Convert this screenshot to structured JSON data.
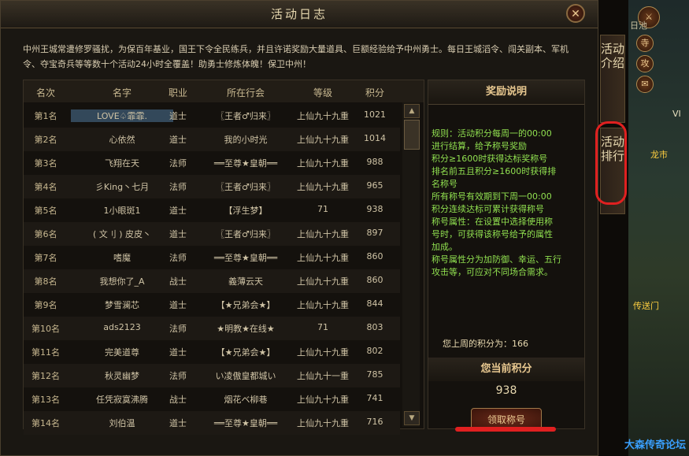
{
  "window": {
    "title": "活动日志",
    "close_label": "✕"
  },
  "intro": "中州王城常遭修罗骚扰，为保百年基业，国王下令全民练兵，并且许诺奖励大量道具、巨额经验给予中州勇士。每日王城滔令、闯关副本、军机令、夺宝奇兵等等数十个活动24小时全覆盖！助勇士修炼体魄！保卫中州！",
  "table": {
    "headers": [
      "名次",
      "名字",
      "职业",
      "所在行会",
      "等级",
      "积分"
    ],
    "rows": [
      {
        "rank": "第1名",
        "name": "LOVE♤霏霏.",
        "job": "道士",
        "guild": "〖王者♂归来〗",
        "level": "上仙九十九重",
        "score": "1021"
      },
      {
        "rank": "第2名",
        "name": "心依然",
        "job": "道士",
        "guild": "我的小时光",
        "level": "上仙九十九重",
        "score": "1014"
      },
      {
        "rank": "第3名",
        "name": "飞翔在天",
        "job": "法师",
        "guild": "══至尊★皇朝══",
        "level": "上仙九十九重",
        "score": "988"
      },
      {
        "rank": "第4名",
        "name": "彡King丶七月",
        "job": "法师",
        "guild": "〖王者♂归来〗",
        "level": "上仙九十九重",
        "score": "965"
      },
      {
        "rank": "第5名",
        "name": "1小眼斑1",
        "job": "道士",
        "guild": "【浮生梦】",
        "level": "71",
        "score": "938"
      },
      {
        "rank": "第6名",
        "name": "( 文刂 ) 皮皮丶",
        "job": "道士",
        "guild": "〖王者♂归来〗",
        "level": "上仙九十九重",
        "score": "897"
      },
      {
        "rank": "第7名",
        "name": "嗜魔",
        "job": "法师",
        "guild": "══至尊★皇朝══",
        "level": "上仙九十九重",
        "score": "860"
      },
      {
        "rank": "第8名",
        "name": "我想你了_A",
        "job": "战士",
        "guild": "義薄云天",
        "level": "上仙九十九重",
        "score": "860"
      },
      {
        "rank": "第9名",
        "name": "梦雪澜芯",
        "job": "道士",
        "guild": "【★兄弟会★】",
        "level": "上仙九十九重",
        "score": "844"
      },
      {
        "rank": "第10名",
        "name": "ads2123",
        "job": "法师",
        "guild": "★明教★在线★",
        "level": "71",
        "score": "803"
      },
      {
        "rank": "第11名",
        "name": "完美道尊",
        "job": "道士",
        "guild": "【★兄弟会★】",
        "level": "上仙九十九重",
        "score": "802"
      },
      {
        "rank": "第12名",
        "name": "秋灵幽梦",
        "job": "法师",
        "guild": "い凌傲皇都城い",
        "level": "上仙九十一重",
        "score": "785"
      },
      {
        "rank": "第13名",
        "name": "任凭寂寞沸腾",
        "job": "战士",
        "guild": "烟花ベ柳巷",
        "level": "上仙九十九重",
        "score": "741"
      },
      {
        "rank": "第14名",
        "name": "刘伯温",
        "job": "道士",
        "guild": "══至尊★皇朝══",
        "level": "上仙九十九重",
        "score": "716"
      }
    ]
  },
  "scrollbar": {
    "up": "▲",
    "down": "▼"
  },
  "reward_panel": {
    "title": "奖励说明",
    "rules": [
      "规则：活动积分每周一的00:00",
      "进行结算，给予称号奖励",
      "积分≥1600时获得达标奖称号",
      "排名前五且积分≥1600时获得排",
      "名称号",
      "所有称号有效期到下周一00:00",
      "积分连续达标可累计获得称号",
      "称号属性：在设置中选择使用称",
      "号时，可获得该称号给予的属性",
      "加成。",
      "称号属性分为加防御、幸运、五行",
      "攻击等，可应对不同场合需求。"
    ],
    "last_week_label": "您上周的积分为：",
    "last_week_value": "166",
    "current_title": "您当前积分",
    "current_value": "938",
    "claim_button": "领取称号"
  },
  "side_tabs": [
    {
      "label": "活动介绍"
    },
    {
      "label": "活动排行"
    }
  ],
  "scene": {
    "buttons": [
      "寺",
      "攻",
      "✉"
    ],
    "labels": [
      "日池",
      "龙市",
      "传送门",
      "VI"
    ],
    "watermark": "大森传奇论坛"
  },
  "colors": {
    "accent_gold": "#e8c890",
    "rule_text": "#90e050",
    "annotation_red": "#e02020"
  }
}
